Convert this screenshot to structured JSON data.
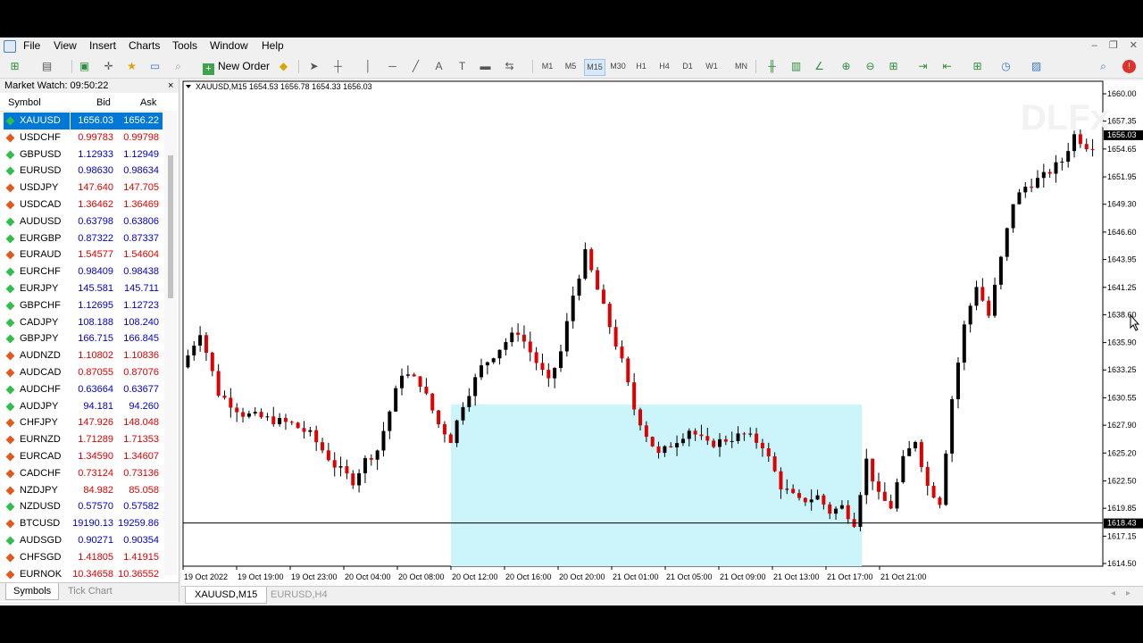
{
  "menu": [
    "File",
    "View",
    "Insert",
    "Charts",
    "Tools",
    "Window",
    "Help"
  ],
  "toolbar": {
    "new_order": "New Order",
    "timeframes": [
      "M1",
      "M5",
      "M15",
      "M30",
      "H1",
      "H4",
      "D1",
      "W1",
      "MN"
    ],
    "active_timeframe": "M15"
  },
  "market_watch": {
    "title": "Market Watch: 09:50:22",
    "close": "×",
    "columns": [
      "Symbol",
      "Bid",
      "Ask"
    ],
    "rows": [
      {
        "symbol": "XAUUSD",
        "bid": "1656.03",
        "ask": "1656.22",
        "dir": "up",
        "color": "#0000cc",
        "selected": true
      },
      {
        "symbol": "USDCHF",
        "bid": "0.99783",
        "ask": "0.99798",
        "dir": "down",
        "color": "#e00000"
      },
      {
        "symbol": "GBPUSD",
        "bid": "1.12933",
        "ask": "1.12949",
        "dir": "up",
        "color": "#0000cc"
      },
      {
        "symbol": "EURUSD",
        "bid": "0.98630",
        "ask": "0.98634",
        "dir": "up",
        "color": "#0000cc"
      },
      {
        "symbol": "USDJPY",
        "bid": "147.640",
        "ask": "147.705",
        "dir": "down",
        "color": "#e00000"
      },
      {
        "symbol": "USDCAD",
        "bid": "1.36462",
        "ask": "1.36469",
        "dir": "down",
        "color": "#e00000"
      },
      {
        "symbol": "AUDUSD",
        "bid": "0.63798",
        "ask": "0.63806",
        "dir": "up",
        "color": "#0000cc"
      },
      {
        "symbol": "EURGBP",
        "bid": "0.87322",
        "ask": "0.87337",
        "dir": "up",
        "color": "#0000cc"
      },
      {
        "symbol": "EURAUD",
        "bid": "1.54577",
        "ask": "1.54604",
        "dir": "down",
        "color": "#e00000"
      },
      {
        "symbol": "EURCHF",
        "bid": "0.98409",
        "ask": "0.98438",
        "dir": "up",
        "color": "#0000cc"
      },
      {
        "symbol": "EURJPY",
        "bid": "145.581",
        "ask": "145.711",
        "dir": "up",
        "color": "#0000cc"
      },
      {
        "symbol": "GBPCHF",
        "bid": "1.12695",
        "ask": "1.12723",
        "dir": "up",
        "color": "#0000cc"
      },
      {
        "symbol": "CADJPY",
        "bid": "108.188",
        "ask": "108.240",
        "dir": "up",
        "color": "#0000cc"
      },
      {
        "symbol": "GBPJPY",
        "bid": "166.715",
        "ask": "166.845",
        "dir": "up",
        "color": "#0000cc"
      },
      {
        "symbol": "AUDNZD",
        "bid": "1.10802",
        "ask": "1.10836",
        "dir": "down",
        "color": "#e00000"
      },
      {
        "symbol": "AUDCAD",
        "bid": "0.87055",
        "ask": "0.87076",
        "dir": "down",
        "color": "#e00000"
      },
      {
        "symbol": "AUDCHF",
        "bid": "0.63664",
        "ask": "0.63677",
        "dir": "up",
        "color": "#0000cc"
      },
      {
        "symbol": "AUDJPY",
        "bid": "94.181",
        "ask": "94.260",
        "dir": "up",
        "color": "#0000cc"
      },
      {
        "symbol": "CHFJPY",
        "bid": "147.926",
        "ask": "148.048",
        "dir": "down",
        "color": "#e00000"
      },
      {
        "symbol": "EURNZD",
        "bid": "1.71289",
        "ask": "1.71353",
        "dir": "down",
        "color": "#e00000"
      },
      {
        "symbol": "EURCAD",
        "bid": "1.34590",
        "ask": "1.34607",
        "dir": "down",
        "color": "#e00000"
      },
      {
        "symbol": "CADCHF",
        "bid": "0.73124",
        "ask": "0.73136",
        "dir": "down",
        "color": "#e00000"
      },
      {
        "symbol": "NZDJPY",
        "bid": "84.982",
        "ask": "85.058",
        "dir": "down",
        "color": "#e00000"
      },
      {
        "symbol": "NZDUSD",
        "bid": "0.57570",
        "ask": "0.57582",
        "dir": "up",
        "color": "#0000cc"
      },
      {
        "symbol": "BTCUSD",
        "bid": "19190.13",
        "ask": "19259.86",
        "dir": "down",
        "color": "#0000cc"
      },
      {
        "symbol": "AUDSGD",
        "bid": "0.90271",
        "ask": "0.90354",
        "dir": "up",
        "color": "#0000cc"
      },
      {
        "symbol": "CHFSGD",
        "bid": "1.41805",
        "ask": "1.41915",
        "dir": "down",
        "color": "#e00000"
      },
      {
        "symbol": "EURNOK",
        "bid": "10.34658",
        "ask": "10.36552",
        "dir": "down",
        "color": "#e00000"
      }
    ],
    "tabs": [
      "Symbols",
      "Tick Chart"
    ]
  },
  "chart_tabs": [
    "XAUUSD,M15",
    "EURUSD,H4"
  ],
  "chart_data": {
    "type": "candlestick",
    "title": "XAUUSD,M15  1654.53 1656.78 1654.33 1656.03",
    "watermark": "DLFx",
    "y_ticks": [
      "1660.00",
      "1657.35",
      "1654.65",
      "1651.95",
      "1649.30",
      "1646.60",
      "1643.95",
      "1641.25",
      "1638.60",
      "1635.90",
      "1633.25",
      "1630.55",
      "1627.90",
      "1625.20",
      "1622.50",
      "1619.85",
      "1617.15",
      "1614.50"
    ],
    "ylim": [
      1614.5,
      1660.0
    ],
    "x_ticks": [
      "19 Oct 2022",
      "19 Oct 19:00",
      "19 Oct 23:00",
      "20 Oct 04:00",
      "20 Oct 08:00",
      "20 Oct 12:00",
      "20 Oct 16:00",
      "20 Oct 20:00",
      "21 Oct 01:00",
      "21 Oct 05:00",
      "21 Oct 09:00",
      "21 Oct 13:00",
      "21 Oct 17:00",
      "21 Oct 21:00"
    ],
    "current_price": "1656.03",
    "hline_price": "1618.43",
    "zone": {
      "from": "20 Oct 12:00",
      "to": "21 Oct 17:30",
      "top": 1629.9,
      "bottom": 1614.5,
      "color": "#ccf5fb"
    },
    "bull_color": "#000000",
    "bear_color": "#e00000",
    "path": [
      [
        0,
        1633.5
      ],
      [
        3,
        1637.0
      ],
      [
        6,
        1631.0
      ],
      [
        10,
        1629.0
      ],
      [
        14,
        1628.5
      ],
      [
        18,
        1628.0
      ],
      [
        21,
        1627.0
      ],
      [
        25,
        1624.0
      ],
      [
        28,
        1622.5
      ],
      [
        30,
        1624.5
      ],
      [
        32,
        1625.5
      ],
      [
        36,
        1633.0
      ],
      [
        39,
        1632.0
      ],
      [
        42,
        1628.0
      ],
      [
        44,
        1626.5
      ],
      [
        46,
        1630.0
      ],
      [
        49,
        1633.5
      ],
      [
        53,
        1636.0
      ],
      [
        55,
        1637.0
      ],
      [
        58,
        1634.0
      ],
      [
        60,
        1632.0
      ],
      [
        62,
        1635.0
      ],
      [
        64,
        1640.5
      ],
      [
        66,
        1644.5
      ],
      [
        68,
        1641.0
      ],
      [
        70,
        1637.5
      ],
      [
        72,
        1634.0
      ],
      [
        74,
        1629.5
      ],
      [
        76,
        1627.0
      ],
      [
        78,
        1625.0
      ],
      [
        80,
        1626.0
      ],
      [
        83,
        1627.5
      ],
      [
        86,
        1626.0
      ],
      [
        89,
        1626.5
      ],
      [
        92,
        1627.0
      ],
      [
        95,
        1626.0
      ],
      [
        98,
        1622.0
      ],
      [
        101,
        1620.5
      ],
      [
        104,
        1621.0
      ],
      [
        106,
        1619.5
      ],
      [
        108,
        1620.0
      ],
      [
        110,
        1618.5
      ],
      [
        112,
        1624.5
      ],
      [
        114,
        1621.0
      ],
      [
        116,
        1620.0
      ],
      [
        118,
        1624.5
      ],
      [
        120,
        1626.5
      ],
      [
        122,
        1622.0
      ],
      [
        124,
        1620.5
      ],
      [
        126,
        1630.5
      ],
      [
        128,
        1637.5
      ],
      [
        130,
        1641.5
      ],
      [
        132,
        1638.5
      ],
      [
        134,
        1644.0
      ],
      [
        136,
        1649.5
      ],
      [
        138,
        1651.0
      ],
      [
        141,
        1652.0
      ],
      [
        144,
        1653.5
      ],
      [
        146,
        1656.0
      ],
      [
        148,
        1655.0
      ]
    ]
  }
}
